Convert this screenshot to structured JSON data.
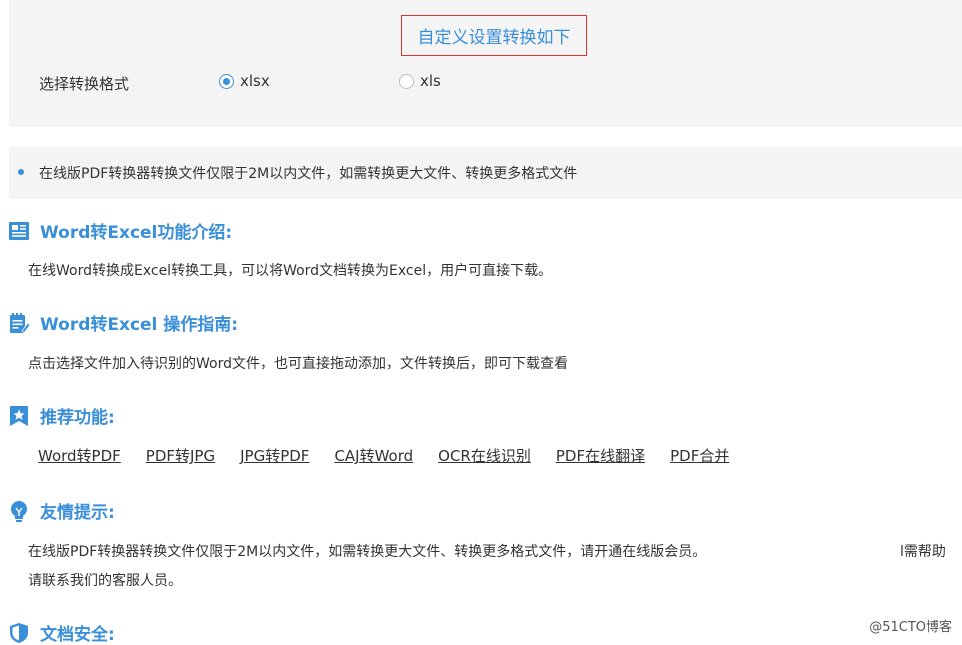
{
  "settings": {
    "title": "自定义设置转换如下",
    "format_label": "选择转换格式",
    "options": [
      {
        "label": "xlsx",
        "checked": true
      },
      {
        "label": "xls",
        "checked": false
      }
    ]
  },
  "notice": {
    "text": "在线版PDF转换器转换文件仅限于2M以内文件，如需转换更大文件、转换更多格式文件"
  },
  "sections": {
    "intro": {
      "title": "Word转Excel功能介绍:",
      "body": "在线Word转换成Excel转换工具，可以将Word文档转换为Excel，用户可直接下载。"
    },
    "guide": {
      "title": "Word转Excel 操作指南:",
      "body": "点击选择文件加入待识别的Word文件，也可直接拖动添加，文件转换后，即可下载查看"
    },
    "recommend": {
      "title": "推荐功能:",
      "links": [
        "Word转PDF",
        "PDF转JPG",
        "JPG转PDF",
        "CAJ转Word",
        "OCR在线识别",
        "PDF在线翻译",
        "PDF合并"
      ]
    },
    "tips": {
      "title": "友情提示:",
      "body_line1": "在线版PDF转换器转换文件仅限于2M以内文件，如需转换更大文件、转换更多格式文件，请开通在线版会员。",
      "body_line1_tail": "l需帮助",
      "body_line2": "请联系我们的客服人员。"
    },
    "security": {
      "title": "文档安全:"
    }
  },
  "watermark": "@51CTO博客",
  "colors": {
    "accent": "#3a8fd9",
    "highlight_border": "#e0322e",
    "panel_bg": "#f4f4f4"
  }
}
